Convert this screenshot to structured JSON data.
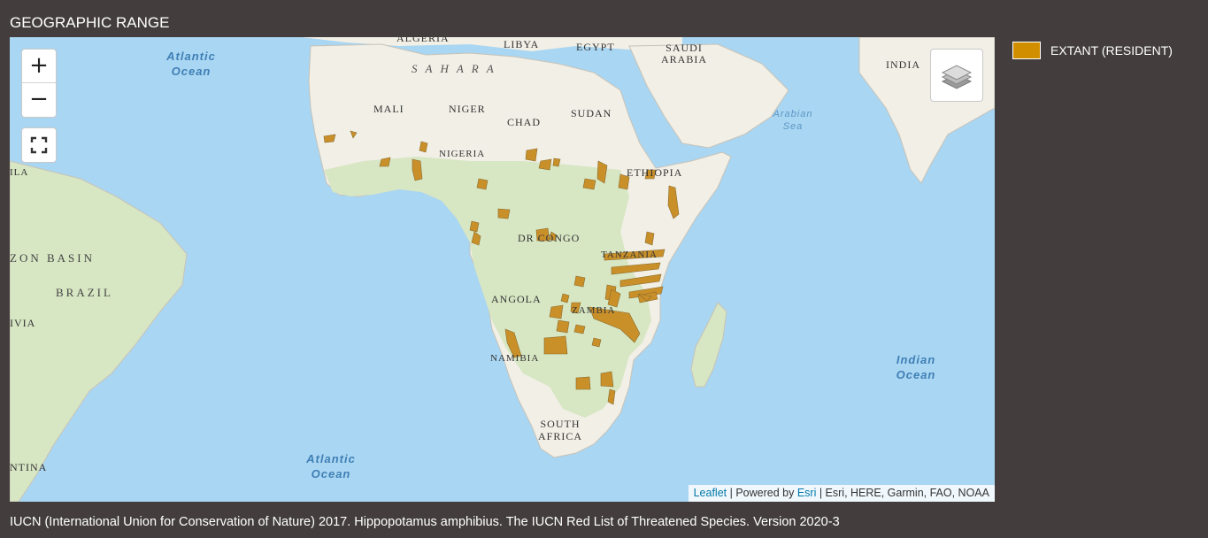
{
  "section": {
    "title": "GEOGRAPHIC RANGE"
  },
  "map": {
    "controls": {
      "zoom_in_label": "+",
      "zoom_out_label": "−",
      "fullscreen_icon": "fullscreen-icon",
      "layers_icon": "layers-icon"
    },
    "labels": {
      "algeria": "ALGERIA",
      "libya": "LIBYA",
      "egypt": "EGYPT",
      "saudi_arabia": "SAUDI ARABIA",
      "india": "INDIA",
      "sahara": "SAHARA",
      "mali": "MALI",
      "niger": "NIGER",
      "chad": "CHAD",
      "sudan": "SUDAN",
      "nigeria": "NIGERIA",
      "ethiopia": "ETHIOPIA",
      "dr_congo": "DR CONGO",
      "tanzania": "TANZANIA",
      "angola": "ANGOLA",
      "zambia": "ZAMBIA",
      "namibia": "NAMIBIA",
      "south_africa": "SOUTH AFRICA",
      "amazon_basin": "ZON BASIN",
      "brazil": "BRAZIL",
      "bolivia": "IVIA",
      "argentina": "NTINA",
      "ila": "ILA",
      "atlantic_ocean_north": "Atlantic Ocean",
      "atlantic_ocean_south": "Atlantic Ocean",
      "arabian_sea": "Arabian Sea",
      "indian_ocean": "Indian Ocean"
    },
    "attribution": {
      "leaflet": "Leaflet",
      "powered_by": " | Powered by ",
      "esri": "Esri",
      "sources": " | Esri, HERE, Garmin, FAO, NOAA"
    },
    "colors": {
      "water": "#a9d6f2",
      "land": "#f1efe6",
      "vegetation": "#d7e6c3",
      "range": "#c9902a",
      "range_stroke": "#8a6a2a"
    }
  },
  "legend": {
    "items": [
      {
        "label": "EXTANT (RESIDENT)",
        "color": "#d18f00"
      }
    ]
  },
  "citation": "IUCN (International Union for Conservation of Nature) 2017. Hippopotamus amphibius. The IUCN Red List of Threatened Species. Version 2020-3"
}
